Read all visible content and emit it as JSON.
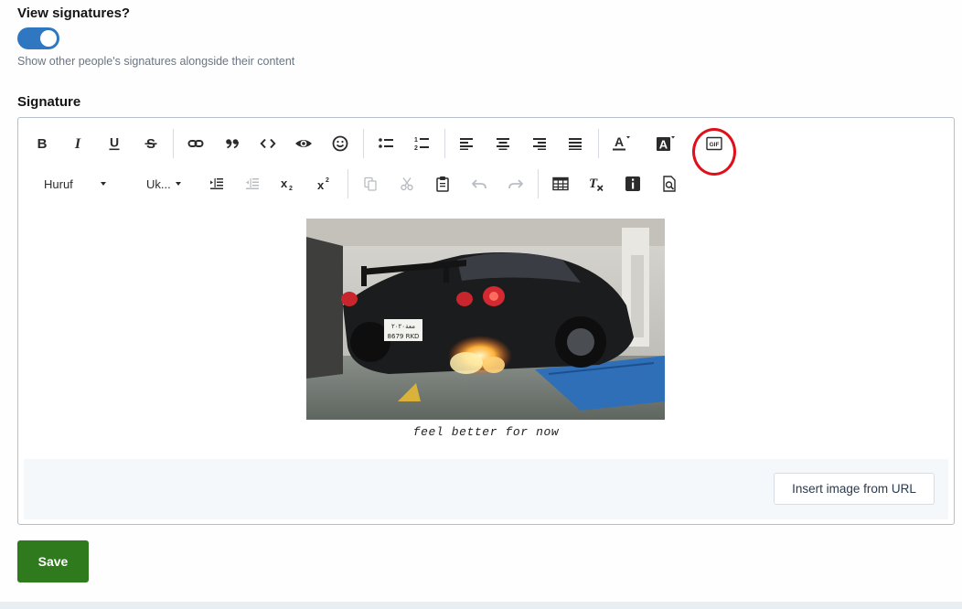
{
  "settings": {
    "view_signatures_label": "View signatures?",
    "view_signatures_on": true,
    "view_signatures_hint": "Show other people's signatures alongside their content",
    "signature_label": "Signature"
  },
  "toolbar": {
    "font_family_label": "Huruf",
    "font_size_label": "Uk...",
    "row1_icons": [
      "bold-icon",
      "italic-icon",
      "underline-icon",
      "strikethrough-icon",
      "link-icon",
      "quote-icon",
      "code-icon",
      "preview-eye-icon",
      "smilie-icon",
      "bulleted-list-icon",
      "numbered-list-icon",
      "align-left-icon",
      "align-center-icon",
      "align-right-icon",
      "align-justify-icon",
      "text-color-icon",
      "background-color-icon",
      "gif-icon"
    ],
    "row2_icons": [
      "indent-icon",
      "outdent-icon",
      "subscript-icon",
      "superscript-icon",
      "copy-icon",
      "cut-icon",
      "paste-icon",
      "undo-icon",
      "redo-icon",
      "table-icon",
      "clear-formatting-icon",
      "info-icon",
      "preview-icon"
    ]
  },
  "editor_content": {
    "caption": "feel better for now",
    "license_plate_line1": "ﻣﻌﺔ٢٠٢٠",
    "license_plate_line2": "8679 RKD"
  },
  "buttons": {
    "insert_image_label": "Insert image from URL",
    "save_label": "Save"
  },
  "colors": {
    "toggle_on": "#2f77c0",
    "save_button": "#2f7a1c",
    "highlight_circle": "#e0101a"
  }
}
